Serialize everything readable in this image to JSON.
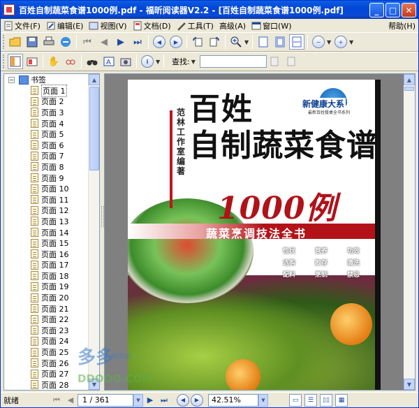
{
  "window": {
    "title": "百姓自制蔬菜食谱1000例.pdf - 福昕阅读器V2.2 - [百姓自制蔬菜食谱1000例.pdf]",
    "min": "_",
    "max": "□",
    "close": "✕"
  },
  "menu": [
    "文件(F)",
    "编辑(E)",
    "视图(V)",
    "文档(D)",
    "工具(T)",
    "高级(A)",
    "窗口(W)",
    "帮助(H)"
  ],
  "toolbar2": {
    "search_label": "查找:",
    "search_value": ""
  },
  "bookmarks": {
    "root": "书签",
    "items": [
      "页面 1",
      "页面 2",
      "页面 3",
      "页面 4",
      "页面 5",
      "页面 6",
      "页面 7",
      "页面 8",
      "页面 9",
      "页面 10",
      "页面 11",
      "页面 12",
      "页面 13",
      "页面 14",
      "页面 15",
      "页面 16",
      "页面 17",
      "页面 18",
      "页面 19",
      "页面 20",
      "页面 21",
      "页面 22",
      "页面 23",
      "页面 24",
      "页面 25",
      "页面 26",
      "页面 27",
      "页面 28"
    ]
  },
  "cover": {
    "title_line1": "百姓",
    "title_line2": "自制蔬菜食谱",
    "author": "范林工作室编著",
    "series_main": "新健康大系",
    "series_sub": "最新百姓餐桌全书系列",
    "big_number": "1000例",
    "subtitle": "蔬菜烹调技法全书",
    "info": [
      [
        "性状",
        "营养",
        "功效"
      ],
      [
        "选购",
        "贮存",
        "清洗"
      ],
      [
        "配料",
        "烹制",
        "禁忌"
      ]
    ]
  },
  "watermark": {
    "big": "多多",
    "small": "软件站",
    "url": "DDOOO.COM"
  },
  "status": {
    "ready": "就绪",
    "page": "1 / 361",
    "zoom": "42.51%"
  }
}
